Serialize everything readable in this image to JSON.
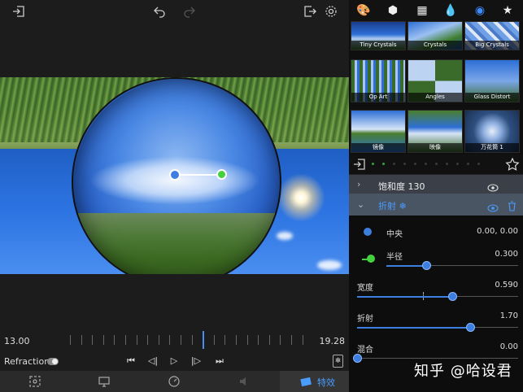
{
  "preview": {
    "timeline_start": "13.00",
    "timeline_end": "19.28"
  },
  "playbar": {
    "filter_name": "Refraction"
  },
  "tabbar": {
    "effects_label": "特效"
  },
  "thumbnails": [
    {
      "caption": "Tiny Crystals"
    },
    {
      "caption": "Crystals"
    },
    {
      "caption": "Big Crystals"
    },
    {
      "caption": "Op Art"
    },
    {
      "caption": "Angles"
    },
    {
      "caption": "Glass Distort"
    },
    {
      "caption": "镜像"
    },
    {
      "caption": "映像"
    },
    {
      "caption": "万花筒 1"
    }
  ],
  "layers": {
    "saturation": "饱和度 130",
    "refraction": "折射 ❄"
  },
  "params": {
    "center": {
      "label": "中央",
      "value": "0.00, 0.00"
    },
    "radius": {
      "label": "半径",
      "value": "0.300",
      "level": 0.3
    },
    "width": {
      "label": "宽度",
      "value": "0.590",
      "level": 0.59
    },
    "refraction": {
      "label": "折射",
      "value": "1.70",
      "level": 0.7
    },
    "mix": {
      "label": "混合",
      "value": "0.00",
      "level": 0.0
    }
  },
  "watermark": "知乎 @哈设君",
  "colors": {
    "accent": "#3d7fe0",
    "green_handle": "#45d040",
    "active_tab_text": "#4a9cff"
  }
}
